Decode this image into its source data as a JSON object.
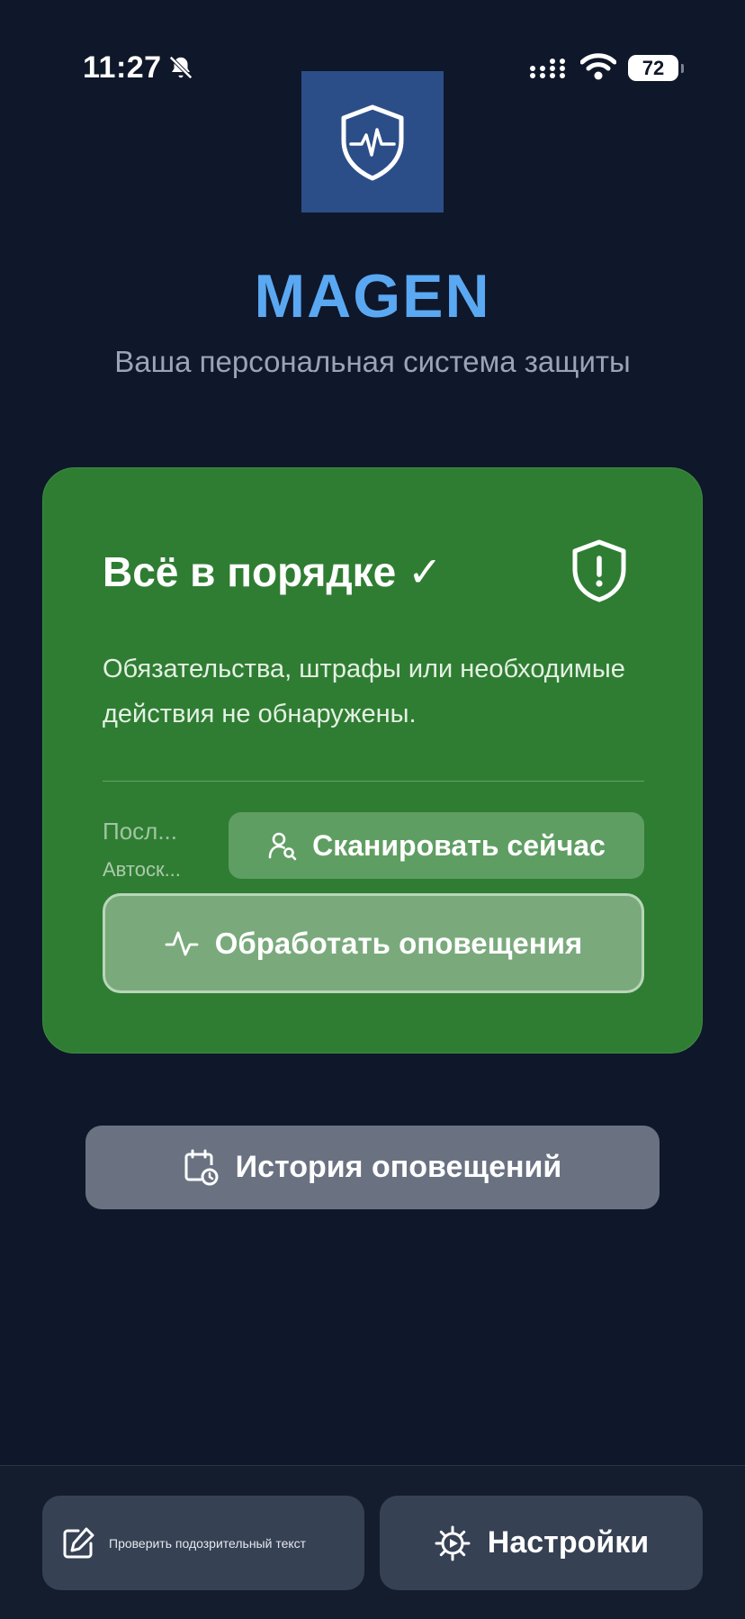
{
  "status_bar": {
    "time": "11:27",
    "battery": "72"
  },
  "header": {
    "app_name": "MAGEN",
    "subtitle": "Ваша персональная система защиты"
  },
  "status_card": {
    "title": "Всё в порядке ✓",
    "description": "Обязательства, штрафы или необходимые действия не обнаружены.",
    "last_scan_label": "Посл...",
    "auto_scan_label": "Автоск...",
    "scan_button_label": "Сканировать сейчас",
    "process_button_label": "Обработать оповещения",
    "background_color": "#2f7d32"
  },
  "history_button_label": "История оповещений",
  "bottom_bar": {
    "check_text_label": "Проверить подозрительный текст",
    "settings_label": "Настройки"
  },
  "colors": {
    "background": "#0f172a",
    "accent": "#5aa8f2"
  }
}
